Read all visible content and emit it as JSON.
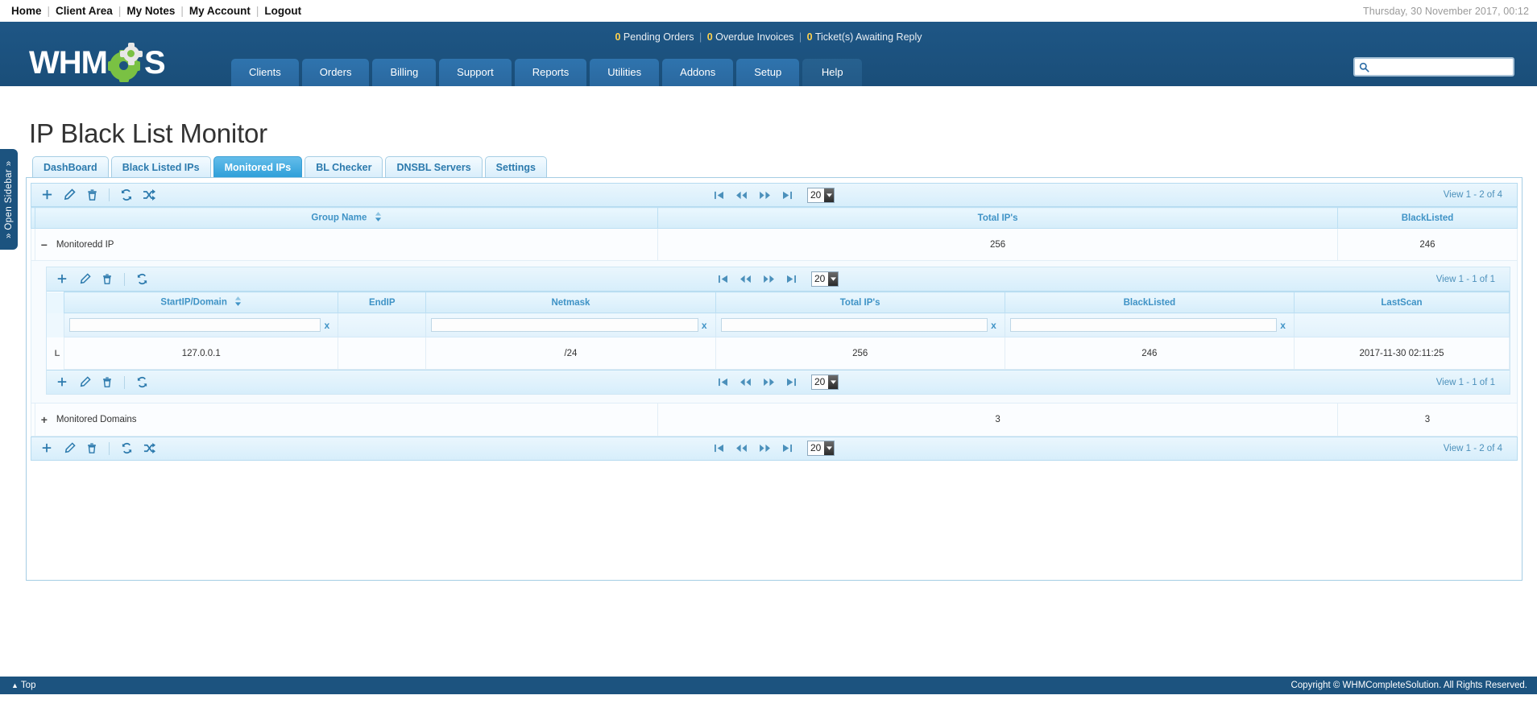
{
  "topbar": {
    "links": [
      "Home",
      "Client Area",
      "My Notes",
      "My Account",
      "Logout"
    ],
    "datetime": "Thursday, 30 November 2017, 00:12"
  },
  "header": {
    "logo_text": "WHM",
    "logo_text_end": "S",
    "stats": {
      "pending_orders_count": "0",
      "pending_orders_label": "Pending Orders",
      "overdue_invoices_count": "0",
      "overdue_invoices_label": "Overdue Invoices",
      "tickets_count": "0",
      "tickets_label": "Ticket(s) Awaiting Reply",
      "separator": "|"
    },
    "search": {
      "value": "",
      "placeholder": ""
    },
    "nav": [
      "Clients",
      "Orders",
      "Billing",
      "Support",
      "Reports",
      "Utilities",
      "Addons",
      "Setup",
      "Help"
    ]
  },
  "sidebar": {
    "toggle_label": "» Open Sidebar »"
  },
  "page": {
    "title": "IP Black List Monitor",
    "tabs": [
      {
        "label": "DashBoard",
        "active": false
      },
      {
        "label": "Black Listed IPs",
        "active": false
      },
      {
        "label": "Monitored IPs",
        "active": true
      },
      {
        "label": "BL Checker",
        "active": false
      },
      {
        "label": "DNSBL Servers",
        "active": false
      },
      {
        "label": "Settings",
        "active": false
      }
    ]
  },
  "outer_grid": {
    "toolbar_top": {
      "icons": [
        "add-icon",
        "edit-icon",
        "delete-icon",
        "refresh-icon",
        "scan-icon"
      ],
      "page_size": "20",
      "view_count": "View 1 - 2 of 4"
    },
    "toolbar_bottom": {
      "icons": [
        "add-icon",
        "edit-icon",
        "delete-icon",
        "refresh-icon",
        "scan-icon"
      ],
      "page_size": "20",
      "view_count": "View 1 - 2 of 4"
    },
    "columns": [
      "Group Name",
      "Total IP's",
      "BlackListed"
    ],
    "rows": [
      {
        "toggle": "−",
        "name": "Monitoredd IP",
        "total_ips": "256",
        "blacklisted": "246",
        "expanded": true
      },
      {
        "toggle": "+",
        "name": "Monitored Domains",
        "total_ips": "3",
        "blacklisted": "3",
        "expanded": false
      }
    ]
  },
  "inner_grid": {
    "toolbar_top": {
      "icons": [
        "add-icon",
        "edit-icon",
        "delete-icon",
        "refresh-icon"
      ],
      "page_size": "20",
      "view_count": "View 1 - 1 of 1"
    },
    "toolbar_bottom": {
      "icons": [
        "add-icon",
        "edit-icon",
        "delete-icon",
        "refresh-icon"
      ],
      "page_size": "20",
      "view_count": "View 1 - 1 of 1"
    },
    "columns": [
      "StartIP/Domain",
      "EndIP",
      "Netmask",
      "Total IP's",
      "BlackListed",
      "LastScan"
    ],
    "filters": [
      {
        "value": "",
        "clear": "x",
        "has_input": true
      },
      {
        "value": "",
        "clear": "",
        "has_input": false
      },
      {
        "value": "",
        "clear": "x",
        "has_input": true
      },
      {
        "value": "",
        "clear": "x",
        "has_input": true
      },
      {
        "value": "",
        "clear": "x",
        "has_input": true
      },
      {
        "value": "",
        "clear": "",
        "has_input": false
      }
    ],
    "rows": [
      {
        "marker": "L",
        "start_ip": "127.0.0.1",
        "end_ip": "",
        "netmask": "/24",
        "total_ips": "256",
        "blacklisted": "246",
        "last_scan": "2017-11-30 02:11:25"
      }
    ]
  },
  "footer": {
    "top_link": "Top",
    "copyright": "Copyright © WHMCompleteSolution. All Rights Reserved."
  }
}
